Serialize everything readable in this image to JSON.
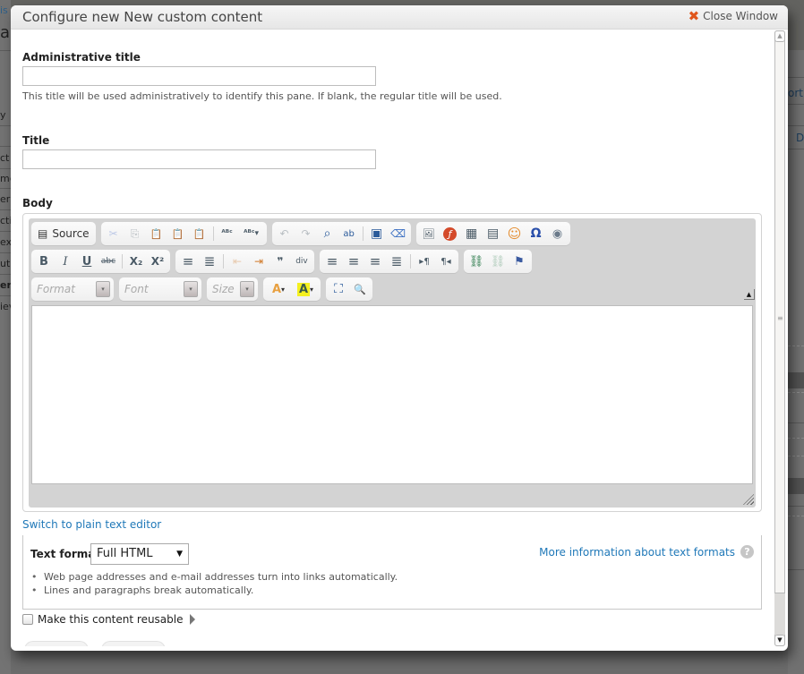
{
  "background_page": {
    "left_fragments": [
      "is",
      "a",
      "y",
      "ct",
      "me",
      "era",
      "ctio",
      "ex",
      "ut",
      "er",
      "iev"
    ],
    "right_fragments": [
      "ort",
      "D"
    ]
  },
  "modal": {
    "title": "Configure new New custom content",
    "close_label": "Close Window"
  },
  "form": {
    "admin_title": {
      "label": "Administrative title",
      "value": "",
      "description": "This title will be used administratively to identify this pane. If blank, the regular title will be used."
    },
    "title": {
      "label": "Title",
      "value": ""
    },
    "body": {
      "label": "Body",
      "toolbar": {
        "row1": {
          "source_label": "Source",
          "buttons": [
            "cut",
            "copy",
            "paste",
            "paste-text",
            "paste-from-word",
            "spell-check",
            "spell-check-as-you-type",
            "undo",
            "redo",
            "find",
            "replace",
            "select-all",
            "remove-format",
            "image",
            "flash",
            "table",
            "horizontal-rule",
            "smiley",
            "special-char",
            "iframe"
          ]
        },
        "row2": {
          "buttons": [
            "bold",
            "italic",
            "underline",
            "strike",
            "subscript",
            "superscript",
            "numbered-list",
            "bulleted-list",
            "outdent",
            "indent",
            "blockquote",
            "create-div",
            "align-left",
            "align-center",
            "align-right",
            "justify",
            "ltr",
            "rtl",
            "link",
            "unlink",
            "anchor"
          ]
        },
        "row3": {
          "format_placeholder": "Format",
          "font_placeholder": "Font",
          "size_placeholder": "Size",
          "buttons": [
            "text-color",
            "background-color",
            "maximize",
            "show-blocks"
          ]
        }
      },
      "content": ""
    },
    "switch_link": "Switch to plain text editor",
    "text_format": {
      "label": "Text format",
      "selected": "Full HTML",
      "more_info_link": "More information about text formats",
      "tips": [
        "Web page addresses and e-mail addresses turn into links automatically.",
        "Lines and paragraphs break automatically."
      ]
    },
    "reusable": {
      "label": "Make this content reusable",
      "checked": false
    }
  },
  "glyphs": {
    "close": "✖",
    "help": "?",
    "scroll_up": "▲",
    "scroll_down": "▼",
    "collapse": "▲",
    "select_arrow": "▼",
    "source": "▤",
    "cut": "✂",
    "copy": "⎘",
    "paste": "📋",
    "paste_text": "📋",
    "paste_word": "📋",
    "spell": "ᴬᴮᶜ",
    "spell2": "ᴬᴮᶜ▾",
    "undo": "↶",
    "redo": "↷",
    "find": "⌕",
    "replace": "ab",
    "select_all": "▣",
    "remove_format": "⌫",
    "image": "🖼",
    "flash": "ƒ",
    "table": "▦",
    "hr": "▤",
    "smiley": "☺",
    "omega": "Ω",
    "globe": "◉",
    "bold": "B",
    "italic": "I",
    "underline": "U",
    "strike": "abc",
    "sub": "X₂",
    "sup": "X²",
    "ol": "≡",
    "ul": "≣",
    "outdent": "⇤",
    "indent": "⇥",
    "quote": "❞",
    "div": "div",
    "align_left": "≡",
    "align_center": "≡",
    "align_right": "≡",
    "justify": "≣",
    "ltr": "▸¶",
    "rtl": "¶◂",
    "link": "⛓",
    "unlink": "⛓",
    "anchor": "⚑",
    "text_color": "A",
    "bg_color": "A",
    "maximize": "⛶",
    "show_blocks": "🔍",
    "dropdown": "▾"
  }
}
